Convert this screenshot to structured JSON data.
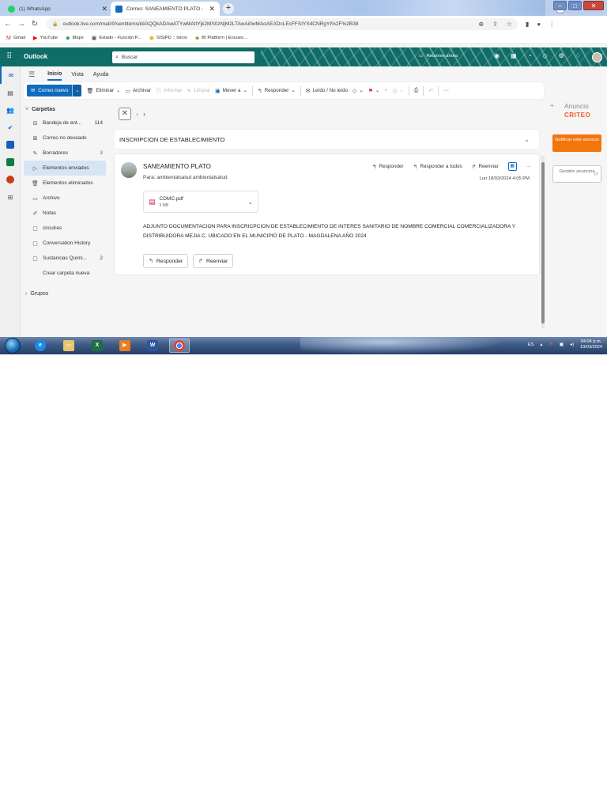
{
  "browser": {
    "tabs": [
      {
        "title": "(1) WhatsApp",
        "active": false
      },
      {
        "title": "Correo: SANEAMIENTO PLATO -",
        "active": true
      }
    ],
    "url": "outlook.live.com/mail/0/sentitems/id/AQQkADAwATYwMAItYjk2MS0zNjM2LTAwAi0wMAoAEADcLEcFFSIYS4CNRgYI%2F%2B38",
    "bookmarks": [
      "Gmail",
      "YouTube",
      "Maps",
      "Estado - Función P...",
      "SISIPD :: Inicio",
      "BI Platform | Encues..."
    ]
  },
  "outlook": {
    "brand": "Outlook",
    "search_placeholder": "Buscar",
    "meet_now": "Reunirse ahora"
  },
  "ribbon_tabs": [
    "Inicio",
    "Vista",
    "Ayuda"
  ],
  "ribbon": {
    "new_mail": "Correo nuevo",
    "delete": "Eliminar",
    "archive": "Archivar",
    "report": "Informar",
    "sweep": "Limpiar",
    "move": "Mover a",
    "reply": "Responder",
    "read_unread": "Leído / No leído"
  },
  "folders": {
    "header": "Carpetas",
    "items": [
      {
        "label": "Bandeja de ent...",
        "count": "114"
      },
      {
        "label": "Correo no deseado",
        "count": ""
      },
      {
        "label": "Borradores",
        "count": "3"
      },
      {
        "label": "Elementos enviados",
        "count": ""
      },
      {
        "label": "Elementos eliminados",
        "count": ""
      },
      {
        "label": "Archivo",
        "count": ""
      },
      {
        "label": "Notas",
        "count": ""
      },
      {
        "label": "circulres",
        "count": ""
      },
      {
        "label": "Conversation History",
        "count": ""
      },
      {
        "label": "Sustancias Quimi...",
        "count": "2"
      }
    ],
    "create_folder": "Crear carpeta nueva",
    "groups": "Grupos"
  },
  "message": {
    "subject": "INSCRIPCION DE ESTABLECIMIENTO",
    "sender": "SANEAMIENTO PLATO",
    "to": "Para:  ambientalsalud ambientalsalud",
    "datetime": "Lun 18/03/2024 4:05 PM",
    "actions": {
      "reply": "Responder",
      "reply_all": "Responder a todos",
      "forward": "Reenviar"
    },
    "attachment": {
      "name": "CDMC.pdf",
      "size": "3 MB"
    },
    "body": "ADJUNTO DOCUMENTACION PARA INSCRICPCION DE ESTABLECIMIENTO DE INTERES SANITARIO DE NOMBRE COMERCIAL COMERCIALIZADORA Y DISTRIBUIDORA MEJIA C, UBICADO EN EL MUNICIPIO DE PLATO - MAGDALENA AÑO 2024",
    "buttons": {
      "reply": "Responder",
      "forward": "Reenviar"
    }
  },
  "ad": {
    "label": "Anuncio",
    "logo": "CRITEO",
    "notify": "Notificar este anuncio",
    "manage": "Gestión anuncios"
  },
  "taskbar": {
    "lang": "ES",
    "time": "04:04 p.m.",
    "date": "19/03/2024"
  },
  "colors": {
    "outlook_header": "#0f6c67",
    "primary": "#0f6cbd",
    "ad_button": "#f4750b",
    "criteo": "#f05a28"
  }
}
